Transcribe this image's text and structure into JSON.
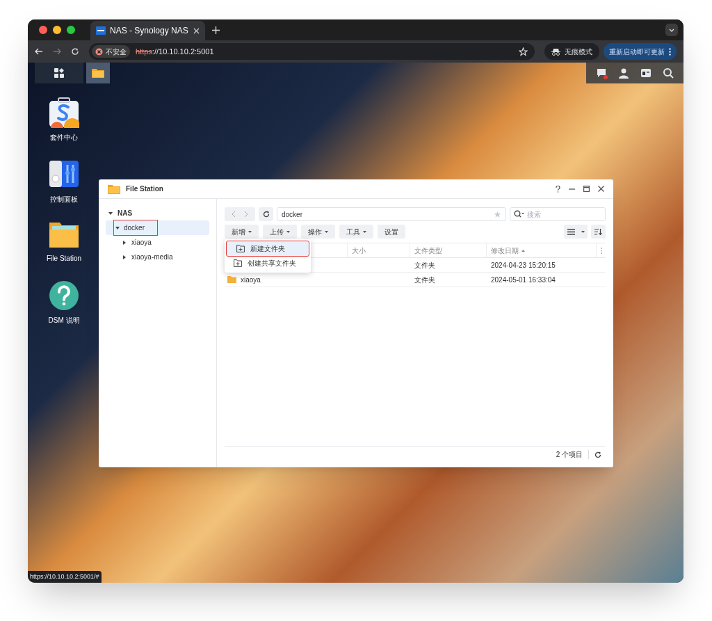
{
  "browser": {
    "tab": {
      "title": "NAS - Synology NAS"
    },
    "security": "不安全",
    "url_scheme": "https",
    "url_rest": "://10.10.10.2:5001",
    "incognito": "无痕模式",
    "update_button": "重新启动即可更新"
  },
  "taskbar": {
    "items": [
      {
        "kind": "grid",
        "selected": false
      },
      {
        "kind": "folder",
        "selected": true
      }
    ],
    "notification": true
  },
  "desktop_icons": [
    {
      "kind": "package",
      "label": "套件中心"
    },
    {
      "kind": "control",
      "label": "控制面板"
    },
    {
      "kind": "folder",
      "label": "File Station"
    },
    {
      "kind": "help",
      "label": "DSM 说明"
    }
  ],
  "file_station": {
    "title": "File Station",
    "tree": {
      "label": "NAS",
      "expanded": true,
      "children": [
        {
          "label": "docker",
          "expanded": true,
          "selected": true,
          "highlighted": true,
          "children": [
            {
              "label": "xiaoya",
              "expanded": false
            },
            {
              "label": "xiaoya-media",
              "expanded": false
            }
          ]
        }
      ]
    },
    "path": "docker",
    "search_placeholder": "搜索",
    "toolbar": [
      {
        "label": "新增",
        "dropdown": true
      },
      {
        "label": "上传",
        "dropdown": true
      },
      {
        "label": "操作",
        "dropdown": true
      },
      {
        "label": "工具",
        "dropdown": true
      },
      {
        "label": "设置",
        "dropdown": false
      }
    ],
    "columns": [
      {
        "label": "大小",
        "sorted": false
      },
      {
        "label": "文件类型",
        "sorted": false
      },
      {
        "label": "修改日期",
        "sorted": true
      }
    ],
    "rows": [
      {
        "type": "文件夹",
        "modified": "2024-04-23 15:20:15"
      },
      {
        "name": "xiaoya",
        "type": "文件夹",
        "modified": "2024-05-01 16:33:04"
      }
    ],
    "menu": [
      {
        "label": "新建文件夹",
        "selected": true,
        "highlighted": true
      },
      {
        "label": "创建共享文件夹",
        "selected": false,
        "highlighted": false
      }
    ],
    "footer": {
      "count": "2 个项目"
    }
  },
  "status_url": "https://10.10.10.2:5001/#"
}
